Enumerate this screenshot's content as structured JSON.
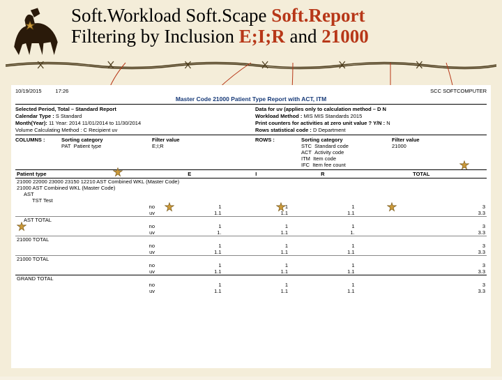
{
  "title": {
    "p1": "Soft.Workload Soft.Scape ",
    "p2": "Soft.Report",
    "p3": "Filtering by Inclusion ",
    "p4": "E;I;R",
    "p5": " and ",
    "p6": "21000"
  },
  "report": {
    "date": "10/19/2015",
    "time": "17:26",
    "org": "SCC SOFTCOMPUTER",
    "title": "Master Code 21000 Patient Type Report with ACT, ITM",
    "left": {
      "period": "Selected Period, Total – Standard Report",
      "caltype_l": "Calendar Type :",
      "caltype_v": "S   Standard",
      "month_l": "Month(Year):",
      "month_v": "11  Year: 2014   11/01/2014 to 11/30/2014",
      "vol_l": "Volume Calculating Method :",
      "vol_v": "C  Recipient uv"
    },
    "right": {
      "data_l": "Data for uv (applies only to calculation method – D N",
      "wkl_l": "Workload Method :",
      "wkl_v": "MIS   MIS Standards 2015",
      "prt_l": "Print counters for activities at zero unit value ? Y/N :",
      "prt_v": "N",
      "row_l": "Rows statistical code :",
      "row_v": "D   Department"
    },
    "cols": {
      "head": "COLUMNS :",
      "sort": "Sorting category",
      "filt": "Filter value",
      "c1": "PAT",
      "c1d": "Patient type",
      "f1": "E;I;R"
    },
    "rows": {
      "head": "ROWS :",
      "sort": "Sorting category",
      "filt": "Filter value",
      "r1": "STC",
      "r1d": "Standard code",
      "f1": "21000",
      "r2": "ACT",
      "r2d": "Activity code",
      "r3": "ITM",
      "r3d": "Item code",
      "r4": "IFC",
      "r4d": "Item fee count"
    },
    "thead": [
      "Patient type",
      "E",
      "I",
      "R",
      "TOTAL"
    ],
    "g1": "21000    22000   23000  23150  12210 AST Combined WKL   (Master Code)",
    "g2": "21000    AST Combined WKL   (Master Code)",
    "g3": "AST",
    "g4": "TST   Test",
    "no": "no",
    "uv": "uv",
    "data": {
      "r_no": [
        "1",
        "1",
        "1",
        "3"
      ],
      "r_uv": [
        "1.1",
        "1.1",
        "1.1",
        "3.3"
      ],
      "ast_l": "AST    TOTAL",
      "a_no": [
        "1",
        "1",
        "1",
        "3"
      ],
      "a_uv": [
        "1.",
        "1.1",
        "1.",
        "3.3"
      ],
      "c21_l": "21000   TOTAL",
      "c_no": [
        "1",
        "1",
        "1",
        "3"
      ],
      "c_uv": [
        "1.1",
        "1.1",
        "1.1",
        "3.3"
      ],
      "c21b_l": "21000   TOTAL",
      "b_no": [
        "1",
        "1",
        "1",
        "3"
      ],
      "b_uv": [
        "1.1",
        "1.1",
        "1.1",
        "3.3"
      ],
      "gt_l": "GRAND TOTAL",
      "g_no": [
        "1",
        "1",
        "1",
        "3"
      ],
      "g_uv": [
        "1.1",
        "1.1",
        "1.1",
        "3.3"
      ]
    }
  }
}
